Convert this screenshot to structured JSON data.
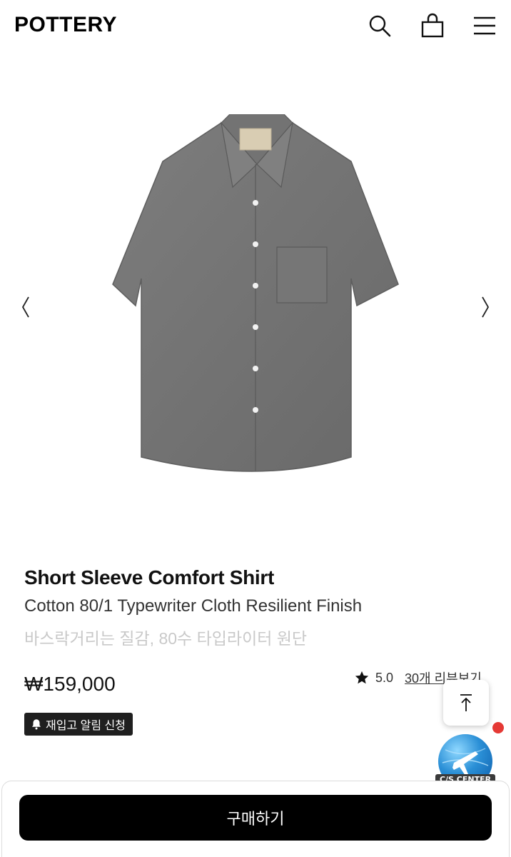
{
  "header": {
    "logo": "POTTERY",
    "icons": [
      "search-icon",
      "shopping-bag-icon",
      "hamburger-menu-icon"
    ]
  },
  "gallery": {
    "icons": [
      "chevron-left-icon",
      "chevron-right-icon"
    ]
  },
  "product": {
    "title": "Short Sleeve Comfort Shirt",
    "subtitle": "Cotton 80/1 Typewriter Cloth Resilient Finish",
    "subtitle_ko": "바스락거리는 질감, 80수 타입라이터 원단",
    "price": "₩159,000",
    "rating": "5.0",
    "review_link": "30개 리뷰보기",
    "restock_label": "재입고 알림 신청"
  },
  "floating": {
    "cs_label": "C/S CENTER",
    "notify_color": "#e53935"
  },
  "bottom_bar": {
    "buy_label": "구매하기"
  },
  "colors": {
    "accent": "#000000",
    "badge_bg": "#1f1f1f",
    "muted_text": "#c9c9c9"
  }
}
